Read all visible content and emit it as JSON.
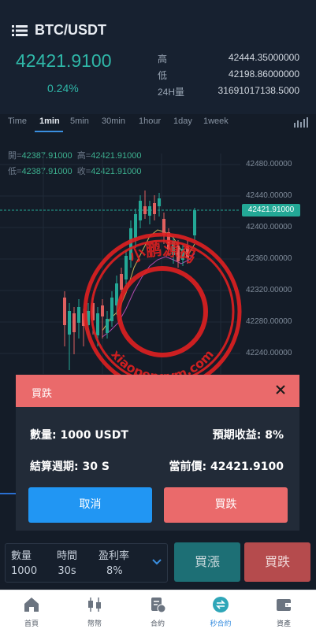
{
  "header": {
    "symbol": "BTC/USDT",
    "last_price": "42421.9100",
    "change_percent": "0.24%",
    "stats": [
      {
        "label": "高",
        "value": "42444.35000000"
      },
      {
        "label": "低",
        "value": "42198.86000000"
      },
      {
        "label": "24H量",
        "value": "31691017138.5000"
      }
    ]
  },
  "tabs": [
    "Time",
    "1min",
    "5min",
    "30min",
    "1hour",
    "1day",
    "1week"
  ],
  "active_tab": "1min",
  "ohlc": {
    "open_label": "開=",
    "open": "42387.91000",
    "high_label": "高=",
    "high": "42421.91000",
    "low_label": "低=",
    "low": "42387.91000",
    "close_label": "收=",
    "close": "42421.91000"
  },
  "chart": {
    "y_ticks": [
      "42480.00000",
      "42440.00000",
      "42400.00000",
      "42360.00000",
      "42320.00000",
      "42280.00000",
      "42240.00000"
    ],
    "current_price_tag": "42421.91000",
    "colors": {
      "up": "#23a896",
      "down": "#e0605f",
      "ma1": "#c9b458",
      "ma2": "#b04bb0"
    }
  },
  "watermark": {
    "top_text": "小鹏源码",
    "bottom_text": "xiaopengym.com",
    "color": "#e02020"
  },
  "modal": {
    "title": "買跌",
    "quantity": "數量: 1000 USDT",
    "expected_return": "預期收益: 8%",
    "settlement": "結算週期: 30 S",
    "current_price": "當前價: 42421.9100",
    "cancel_label": "取消",
    "confirm_label": "買跌"
  },
  "order_panel": {
    "quantity_label": "數量",
    "quantity_value": "1000",
    "time_label": "時間",
    "time_value": "30s",
    "rate_label": "盈利率",
    "rate_value": "8%"
  },
  "buttons": {
    "rise": "買漲",
    "fall": "買跌"
  },
  "tabbar": [
    {
      "label": "首頁",
      "icon": "home-icon"
    },
    {
      "label": "幣幣",
      "icon": "candlestick-icon"
    },
    {
      "label": "合約",
      "icon": "contract-icon"
    },
    {
      "label": "秒合約",
      "icon": "exchange-icon"
    },
    {
      "label": "資產",
      "icon": "wallet-icon"
    }
  ],
  "active_tabbar": "秒合約",
  "accent_color": "#3a8fe0"
}
